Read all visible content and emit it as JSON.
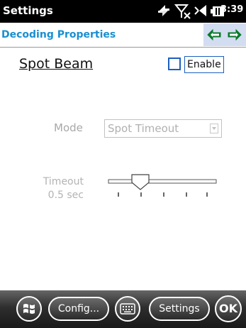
{
  "status_bar": {
    "title": "Settings",
    "time": "3:39",
    "icons": [
      "connectivity-icon",
      "no-signal-icon",
      "volume-icon",
      "battery-icon"
    ]
  },
  "header": {
    "title": "Decoding Properties",
    "nav": [
      "back-arrow-icon",
      "forward-arrow-icon"
    ],
    "title_color": "#1a8fd0",
    "nav_bg": "#d3ddf2"
  },
  "spot_beam": {
    "title": "Spot Beam",
    "enable_label": "Enable",
    "enabled": false
  },
  "mode": {
    "label": "Mode",
    "selected": "Spot Timeout"
  },
  "timeout": {
    "label": "Timeout",
    "value": "0.5 sec",
    "slider_position": 0.3
  },
  "bottom_bar": {
    "config_label": "Config...",
    "settings_label": "Settings",
    "ok_label": "OK",
    "icons": [
      "windows-start-icon",
      "keyboard-icon"
    ]
  }
}
